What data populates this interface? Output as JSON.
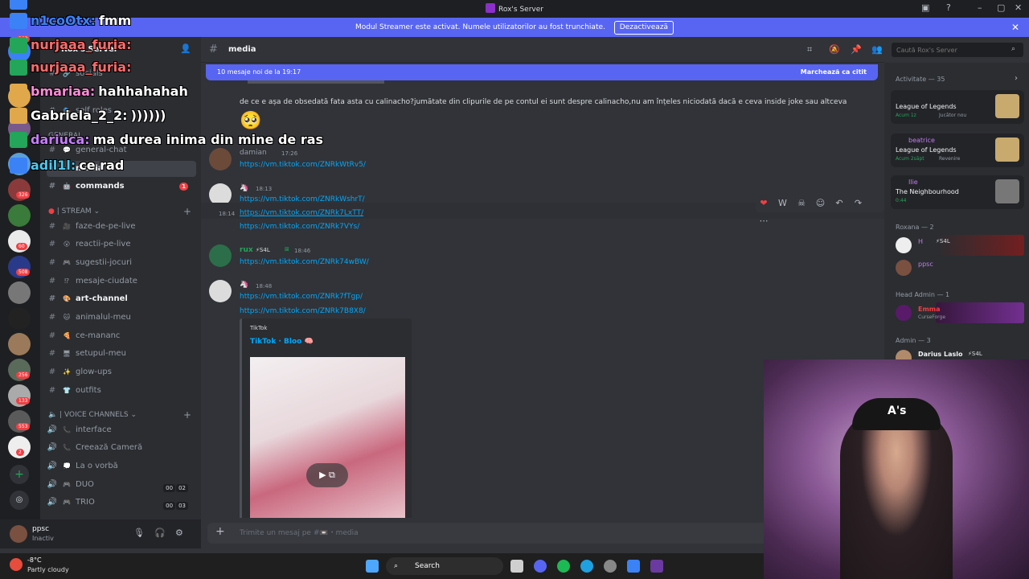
{
  "window": {
    "title": "Rox's Server"
  },
  "banner": {
    "text": "Modul Streamer este activat. Numele utilizatorilor au fost trunchiate.",
    "button": "Dezactivează"
  },
  "rail": {
    "badges": [
      "303",
      "326",
      "60",
      "508",
      "256",
      "133",
      "553",
      "2"
    ]
  },
  "sidebar": {
    "server_name": "Rox's Server",
    "channels_top": [
      {
        "label": "socials"
      },
      {
        "label": "self roles"
      },
      {
        "label": "general-chat"
      },
      {
        "label": "media"
      },
      {
        "label": "commands",
        "badge": "1"
      }
    ],
    "category_stream": "| STREAM",
    "stream_channels": [
      "faze-de-pe-live",
      "reactii-pe-live",
      "sugestii-jocuri",
      "mesaje-ciudate",
      "art-channel",
      "animalul-meu",
      "ce-mananc",
      "setupul-meu",
      "glow-ups",
      "outfits"
    ],
    "category_voice": "| VOICE CHANNELS",
    "voice_channels": [
      {
        "label": "interface"
      },
      {
        "label": "Creează Cameră"
      },
      {
        "label": "La o vorbă"
      },
      {
        "label": "DUO",
        "counts": [
          "00",
          "02"
        ]
      },
      {
        "label": "TRIO",
        "counts": [
          "00",
          "03"
        ]
      }
    ],
    "category_general": "GENERAL"
  },
  "user_panel": {
    "name": "ppsc",
    "status": "Inactiv"
  },
  "header": {
    "channel": "media"
  },
  "search": {
    "placeholder": "Caută Rox's Server"
  },
  "newbar": {
    "left": "10 mesaje noi de la 19:17",
    "right": "Marchează ca citit"
  },
  "messages": {
    "intro_text": "de ce e așa de obsedată fata asta cu calinacho?jumătate din clipurile de pe contul ei sunt despre calinacho,nu am înțeles niciodată dacă e ceva inside joke sau altceva",
    "m1": {
      "name": "damian",
      "time": "17:26",
      "link": "https://vm.tiktok.com/ZNRkWtRv5/"
    },
    "m2": {
      "time": "18:13",
      "links": [
        "https://vm.tiktok.com/ZNRkWshrT/",
        "https://vm.tiktok.com/ZNRk7LxTT/",
        "https://vm.tiktok.com/ZNRk7VYs/"
      ],
      "hover_time": "18:14"
    },
    "m3": {
      "name": "rux",
      "tag": "S4L",
      "time": "18:46",
      "link": "https://vm.tiktok.com/ZNRk74wBW/"
    },
    "m4": {
      "time": "18:48",
      "links": [
        "https://vm.tiktok.com/ZNRk7fTgp/",
        "https://vm.tiktok.com/ZNRk7B8X8/"
      ]
    },
    "embed": {
      "provider": "TikTok",
      "title": "TikTok · Bloo 🧠"
    }
  },
  "composer": {
    "placeholder": "Trimite un mesaj pe #📼・media"
  },
  "members": {
    "activity_header": "Activitate — 35",
    "activities": [
      {
        "who": "",
        "game": "League of Legends",
        "meta": "Acum 1z",
        "meta2": "Jucător nou"
      },
      {
        "who": "beatrice",
        "game": "League of Legends",
        "meta": "Acum 2săpt",
        "meta2": "Revenire"
      },
      {
        "who": "Ilie",
        "game": "The Neighbourhood",
        "meta": "0:44",
        "meta2": ""
      }
    ],
    "roxana_header": "Roxana — 2",
    "roxana_members": [
      {
        "name": "H",
        "tag": "S4L"
      },
      {
        "name": "ppsc"
      }
    ],
    "headadmin_header": "Head Admin — 1",
    "headadmin_members": [
      {
        "name": "Emma",
        "status": "CurseForge"
      }
    ],
    "admin_header": "Admin — 3",
    "admin_members": [
      {
        "name": "Darius Laslo",
        "tag": "S4L"
      }
    ]
  },
  "stream_chat": [
    {
      "user": "",
      "msg": "",
      "color": "#ff4b4b"
    },
    {
      "user": "n1coOtx:",
      "msg": "fmm",
      "color": "#3b82f6"
    },
    {
      "user": "nurjaaa_furia:",
      "msg": "",
      "color": "#ff6b6b"
    },
    {
      "user": "nurjaaa_furia:",
      "msg": "",
      "color": "#ff6b6b"
    },
    {
      "user": "bmariaa:",
      "msg": "hahhahahah",
      "color": "#ff8ad8"
    },
    {
      "user": "Gabriela_2_2:",
      "msg": "))))))",
      "color": "#ffffff"
    },
    {
      "user": "dariuca:",
      "msg": "ma durea inima din mine de ras",
      "color": "#c77dff"
    },
    {
      "user": "adil1l:",
      "msg": "ce rad",
      "color": "#4cc9f0"
    }
  ],
  "taskbar": {
    "temp": "-8°C",
    "weather": "Partly cloudy",
    "search": "Search"
  },
  "colors": {
    "blurple": "#5865f2",
    "link": "#00a8fc",
    "bg": "#313338"
  }
}
